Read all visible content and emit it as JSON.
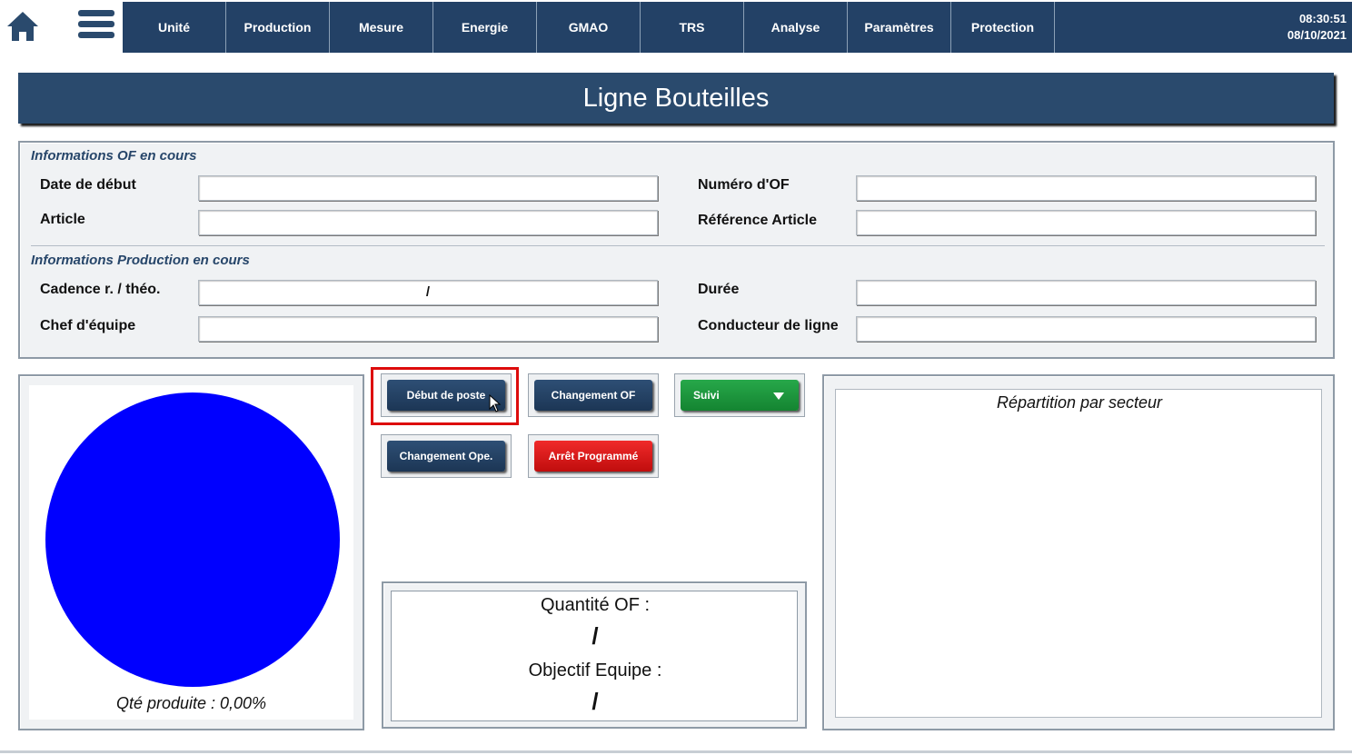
{
  "header": {
    "nav": [
      "Unité",
      "Production",
      "Mesure",
      "Energie",
      "GMAO",
      "TRS",
      "Analyse",
      "Paramètres",
      "Protection"
    ],
    "time": "08:30:51",
    "date": "08/10/2021"
  },
  "page_title": "Ligne Bouteilles",
  "info_of": {
    "section_title": "Informations OF en cours",
    "date_debut_label": "Date de début",
    "date_debut_value": "",
    "numero_of_label": "Numéro d'OF",
    "numero_of_value": "",
    "article_label": "Article",
    "article_value": "",
    "reference_label": "Référence Article",
    "reference_value": ""
  },
  "info_production": {
    "section_title": "Informations Production en cours",
    "cadence_label": "Cadence r. / théo.",
    "cadence_value": "/",
    "duree_label": "Durée",
    "duree_value": "",
    "chef_label": "Chef d'équipe",
    "chef_value": "",
    "conducteur_label": "Conducteur de ligne",
    "conducteur_value": ""
  },
  "gauge": {
    "label": "Qté produite : 0,00%",
    "value_percent": 0.0,
    "color": "#0000ff"
  },
  "actions": {
    "debut_poste": "Début de poste",
    "changement_of": "Changement OF",
    "suivi": "Suivi",
    "changement_ope": "Changement Ope.",
    "arret_programme": "Arrêt Programmé"
  },
  "quantities": {
    "quantite_of_label": "Quantité OF :",
    "quantite_of_value": "/",
    "objectif_label": "Objectif Equipe :",
    "objectif_value": "/"
  },
  "repartition": {
    "title": "Répartition par secteur"
  },
  "colors": {
    "nav_bg": "#234166",
    "title_bg": "#2a4a6d",
    "highlight": "#dd0c0c",
    "suivi_green": "#1f9a3f",
    "arret_red": "#e01a1a"
  }
}
